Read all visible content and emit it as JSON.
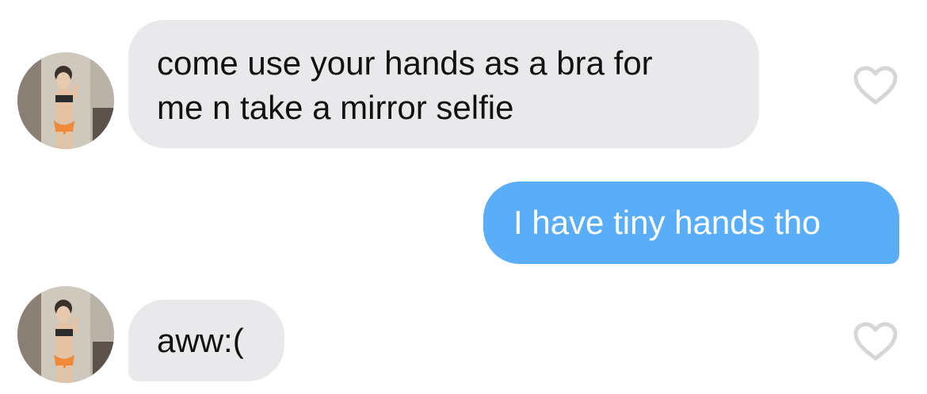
{
  "conversation": {
    "messages": [
      {
        "sender": "them",
        "text": "come use your hands as a bra for\nme n take a mirror selfie",
        "like_icon": "heart-outline-icon",
        "avatar": "contact-avatar"
      },
      {
        "sender": "me",
        "text": "I have tiny hands tho"
      },
      {
        "sender": "them",
        "text": "aww:(",
        "like_icon": "heart-outline-icon",
        "avatar": "contact-avatar"
      }
    ]
  },
  "colors": {
    "incoming_bubble": "#e9e9eb",
    "outgoing_bubble": "#5aaef7",
    "heart_outline": "#d6d6d6",
    "background": "#ffffff"
  }
}
